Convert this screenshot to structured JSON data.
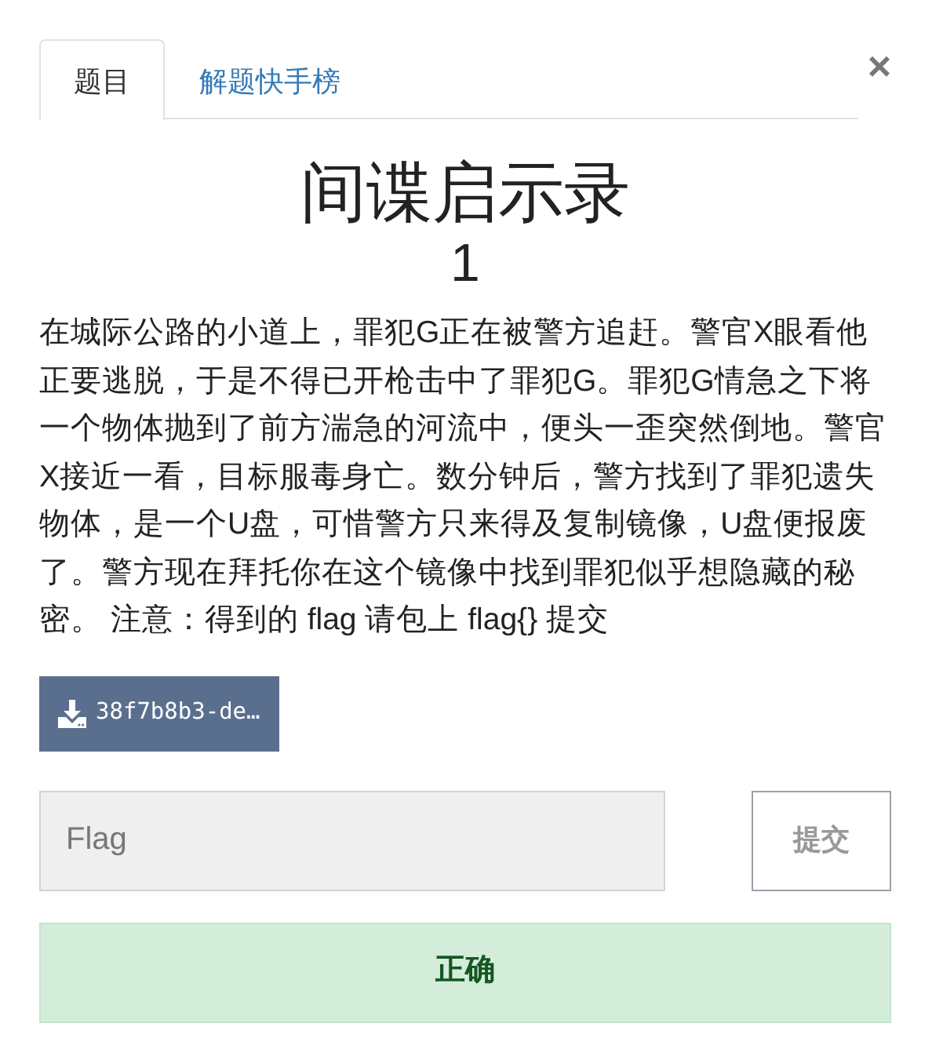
{
  "tabs": [
    {
      "label": "题目",
      "selected": true
    },
    {
      "label": "解题快手榜",
      "selected": false
    }
  ],
  "close_button": {
    "label": "×"
  },
  "challenge": {
    "title": "间谍启示录",
    "points": "1",
    "description": "在城际公路的小道上，罪犯G正在被警方追赶。警官X眼看他正要逃脱，于是不得已开枪击中了罪犯G。罪犯G情急之下将一个物体抛到了前方湍急的河流中，便头一歪突然倒地。警官X接近一看，目标服毒身亡。数分钟后，警方找到了罪犯遗失物体，是一个U盘，可惜警方只来得及复制镜像，U盘便报废了。警方现在拜托你在这个镜像中找到罪犯似乎想隐藏的秘密。 注意：得到的 flag 请包上 flag{} 提交",
    "attachment": {
      "label": "38f7b8b3-de…"
    }
  },
  "flag_form": {
    "placeholder": "Flag",
    "submit_label": "提交"
  },
  "result": {
    "kind": "success",
    "message": "正确"
  }
}
